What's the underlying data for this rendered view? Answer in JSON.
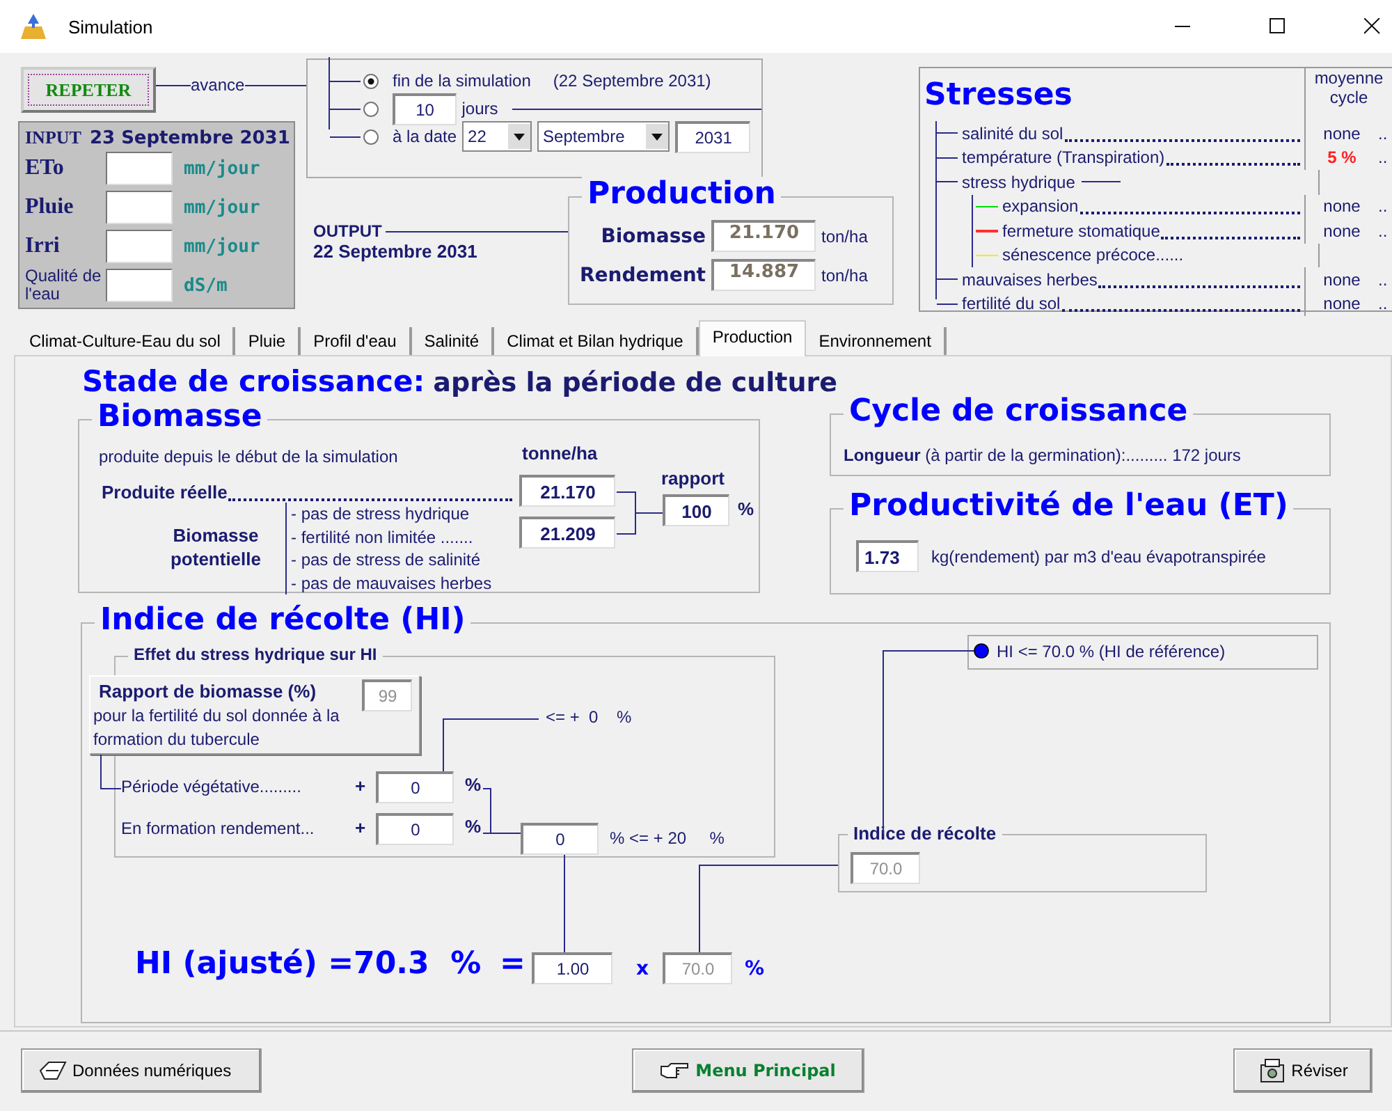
{
  "window": {
    "title": "Simulation"
  },
  "repeat_button": "REPETER",
  "advance": {
    "label": "avance",
    "options": [
      {
        "kind": "end",
        "label": "fin de la simulation",
        "date": "(22 Septembre 2031)",
        "selected": true
      },
      {
        "kind": "days",
        "value": "10",
        "unit": "jours",
        "selected": false
      },
      {
        "kind": "date",
        "label": "à la date",
        "day": "22",
        "month": "Septembre",
        "year": "2031",
        "selected": false
      }
    ]
  },
  "input": {
    "label": "INPUT",
    "date": "23 Septembre 2031",
    "fields": [
      {
        "kind": "main",
        "label": "ETo",
        "unit": "mm/jour"
      },
      {
        "kind": "main",
        "label": "Pluie",
        "unit": "mm/jour"
      },
      {
        "kind": "main",
        "label": "Irri",
        "unit": "mm/jour"
      },
      {
        "kind": "small",
        "label": "Qualité de l'eau",
        "unit": "dS/m"
      }
    ]
  },
  "output": {
    "label": "OUTPUT",
    "date": "22 Septembre 2031"
  },
  "production": {
    "title": "Production",
    "rows": [
      {
        "label": "Biomasse",
        "value": "21.170",
        "unit": "ton/ha"
      },
      {
        "label": "Rendement",
        "value": "14.887",
        "unit": "ton/ha"
      }
    ]
  },
  "stresses": {
    "title": "Stresses",
    "column_header": "moyenne cycle",
    "items": [
      {
        "label": "salinité du sol",
        "value": "none",
        "warning": false,
        "tail": ".."
      },
      {
        "label": "température (Transpiration)",
        "value": "5 %",
        "warning": true,
        "tail": ".."
      },
      {
        "label": "stress hydrique",
        "children": [
          {
            "label": "expansion",
            "value": "none",
            "warning": false,
            "tail": "..",
            "color": "#00dd00"
          },
          {
            "label": "fermeture stomatique",
            "value": "none",
            "warning": false,
            "tail": "..",
            "color": "#ff3030"
          },
          {
            "label": "sénescence précoce......",
            "color": "#f0f000"
          }
        ]
      },
      {
        "label": "mauvaises herbes",
        "value": "none",
        "warning": false,
        "tail": ".."
      },
      {
        "label": "fertilité du sol",
        "value": "none",
        "warning": false,
        "tail": ".."
      }
    ]
  },
  "tabs": [
    {
      "label": "Climat-Culture-Eau du sol",
      "selected": false
    },
    {
      "label": "Pluie",
      "selected": false
    },
    {
      "label": "Profil d'eau",
      "selected": false
    },
    {
      "label": "Salinité",
      "selected": false
    },
    {
      "label": "Climat et Bilan hydrique",
      "selected": false
    },
    {
      "label": "Production",
      "selected": true
    },
    {
      "label": "Environnement",
      "selected": false
    }
  ],
  "growth_stage": {
    "label": "Stade de croissance:",
    "value": "après la période de culture"
  },
  "biomass": {
    "title": "Biomasse",
    "subtitle": "produite depuis le début de la simulation",
    "unit_header": "tonne/ha",
    "actual": {
      "label": "Produite réelle",
      "value": "21.170"
    },
    "potential": {
      "label": "Biomasse potentielle",
      "conditions": [
        "- pas de stress hydrique",
        "- fertilité non limitée  .......",
        "- pas de stress de salinité",
        "- pas de mauvaises herbes"
      ],
      "value": "21.209"
    },
    "ratio": {
      "label": "rapport",
      "value": "100",
      "unit": "%"
    }
  },
  "cycle": {
    "title": "Cycle de croissance",
    "text": "**Longueur** (à partir de la germination):......... 172 jours"
  },
  "water_productivity": {
    "title": "Productivité de l'eau (ET)",
    "value": "1.73",
    "text": "kg(rendement) par m3 d'eau évapotranspirée"
  },
  "harvest_index": {
    "title": "Indice de récolte (HI)",
    "water_stress": {
      "title": "Effet du stress hydrique sur HI",
      "biomass_ratio": {
        "label": "Rapport de biomasse (%)",
        "note": "pour la fertilité du sol donnée à la formation du tubercule",
        "value": "99"
      },
      "upper_limit": "<= +  0    %",
      "rows": [
        {
          "label": "Période végétative.........",
          "sign": "+",
          "value": "0",
          "unit": "%"
        },
        {
          "label": "En formation rendement...",
          "sign": "+",
          "value": "0",
          "unit": "%"
        }
      ],
      "total": {
        "value": "0",
        "limit": "% <= + 20     %"
      }
    },
    "reference": "HI <=  70.0 %  (HI de référence)",
    "index": {
      "label": "Indice de récolte",
      "value": "70.0"
    },
    "adjusted": {
      "label": "HI (ajusté) =70.3  %",
      "equals": "=",
      "factor": "1.00",
      "times": "x",
      "hi": "70.0",
      "unit": "%"
    }
  },
  "footer_buttons": [
    {
      "kind": "data",
      "label": "Données numériques"
    },
    {
      "kind": "menu",
      "label": "Menu Principal"
    },
    {
      "kind": "revise",
      "label": "Réviser"
    }
  ]
}
